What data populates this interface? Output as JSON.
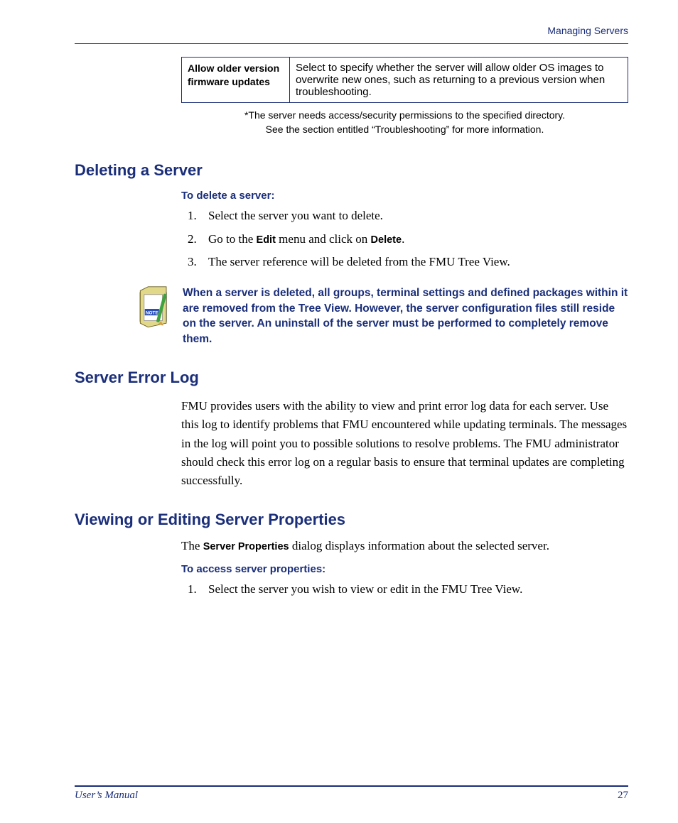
{
  "header": {
    "section": "Managing Servers"
  },
  "table": {
    "label": "Allow older version firmware updates",
    "desc": "Select to specify whether the server will allow older OS images to overwrite new ones, such as returning to a previous version when troubleshooting."
  },
  "footnote": {
    "line1": "*The server needs access/security permissions to the specified directory.",
    "line2": "See the section entitled “Troubleshooting” for more information."
  },
  "sec1": {
    "title": "Deleting a Server",
    "subhead": "To delete a server:",
    "step1": "Select the server you want to delete.",
    "step2_a": "Go to the ",
    "step2_edit": "Edit",
    "step2_b": " menu and click on ",
    "step2_delete": "Delete",
    "step2_c": ".",
    "step3": "The server reference will be deleted from the FMU Tree View.",
    "note": "When a server is deleted, all groups, terminal settings and defined packages within it are removed from the Tree View. However, the server configuration files still reside on the server. An uninstall of the server must be performed to completely remove them."
  },
  "sec2": {
    "title": "Server Error Log",
    "para": "FMU provides users with the ability to view and print error log data for each server. Use this log to identify problems that FMU encountered while updating terminals. The messages in the log will point you to possible solutions to resolve problems. The FMU administrator should check this error log on a regular basis to ensure that terminal updates are completing successfully."
  },
  "sec3": {
    "title": "Viewing or Editing Server Properties",
    "intro_a": "The ",
    "intro_term": "Server Properties",
    "intro_b": " dialog displays information about the selected server.",
    "subhead": "To access server properties:",
    "step1": "Select the server you wish to view or edit in the FMU Tree View."
  },
  "footer": {
    "left": "User’s Manual",
    "right": "27"
  }
}
